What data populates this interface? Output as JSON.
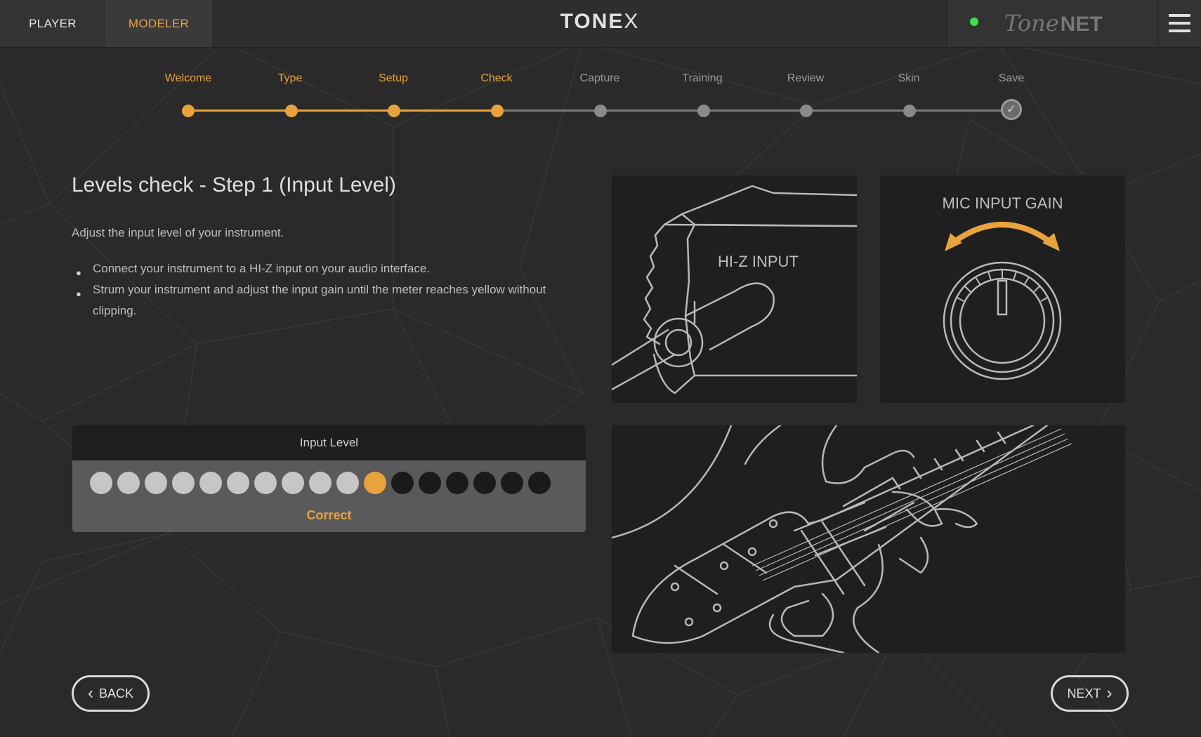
{
  "header": {
    "tabs": [
      {
        "label": "PLAYER"
      },
      {
        "label": "MODELER"
      }
    ],
    "brand": {
      "main": "TONE",
      "mark": "X"
    },
    "network": {
      "tone": "Tone",
      "net": "NET",
      "status_color": "#3ee04a"
    }
  },
  "stepper": {
    "steps": [
      {
        "label": "Welcome",
        "state": "done"
      },
      {
        "label": "Type",
        "state": "done"
      },
      {
        "label": "Setup",
        "state": "done"
      },
      {
        "label": "Check",
        "state": "current"
      },
      {
        "label": "Capture",
        "state": "todo"
      },
      {
        "label": "Training",
        "state": "todo"
      },
      {
        "label": "Review",
        "state": "todo"
      },
      {
        "label": "Skin",
        "state": "todo"
      },
      {
        "label": "Save",
        "state": "final"
      }
    ]
  },
  "content": {
    "title": "Levels check - Step 1 (Input Level)",
    "description": "Adjust the input level of your instrument.",
    "bullets": [
      "Connect your instrument to a HI-Z input on your audio interface.",
      "Strum your instrument and adjust the input gain until the meter reaches yellow without clipping."
    ]
  },
  "meter": {
    "title": "Input Level",
    "status": "Correct",
    "total_leds": 17,
    "lit_leds": 10,
    "peak_led": 11
  },
  "panels": {
    "hiz_label": "HI-Z INPUT",
    "gain_label": "MIC INPUT GAIN"
  },
  "nav": {
    "back": "BACK",
    "next": "NEXT"
  },
  "colors": {
    "accent": "#e8a33d",
    "background": "#2a2a2a",
    "inactive": "#8a8a8a"
  }
}
